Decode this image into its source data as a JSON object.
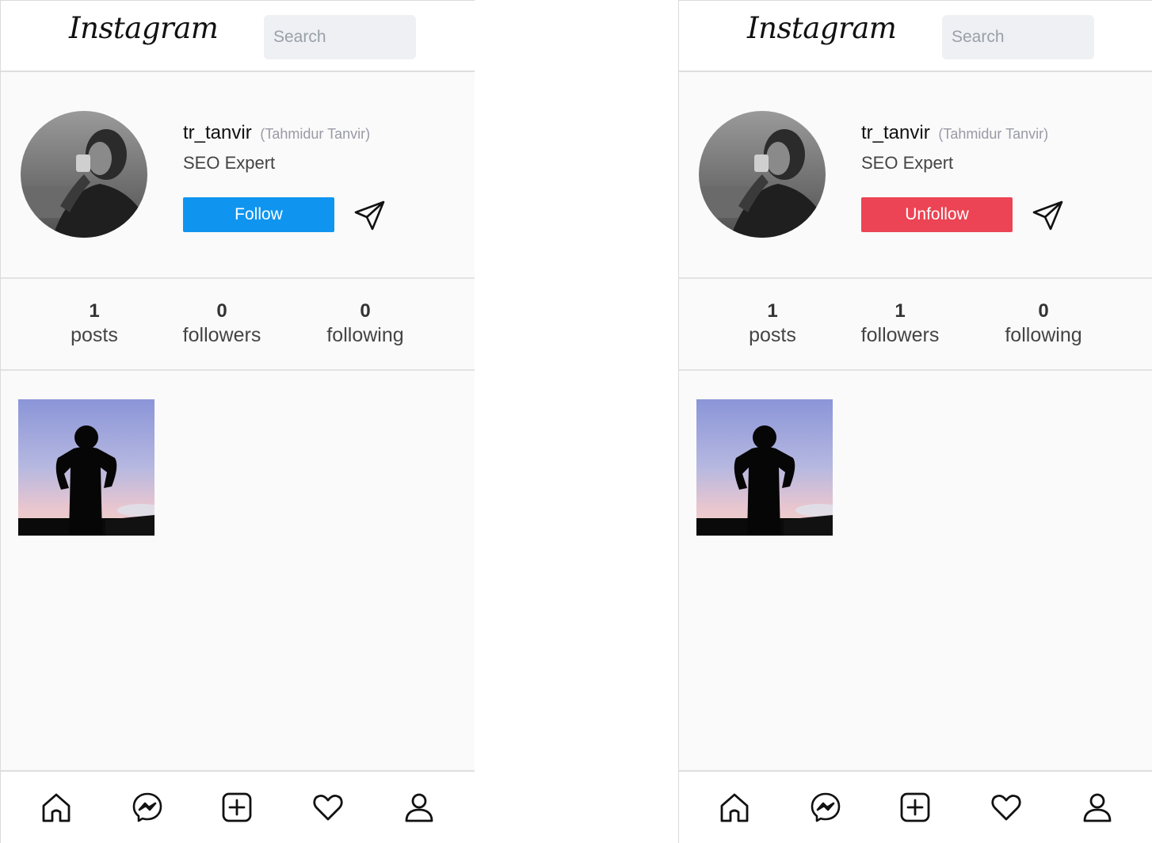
{
  "screens": [
    {
      "logo": "Instagram",
      "search_placeholder": "Search",
      "username": "tr_tanvir",
      "full_name": "(Tahmidur Tanvir)",
      "bio": "SEO Expert",
      "action_button": "Follow",
      "stats": [
        {
          "value": "1",
          "label": "posts"
        },
        {
          "value": "0",
          "label": "followers"
        },
        {
          "value": "0",
          "label": "following"
        }
      ]
    },
    {
      "logo": "Instagram",
      "search_placeholder": "Search",
      "username": "tr_tanvir",
      "full_name": "(Tahmidur Tanvir)",
      "bio": "SEO Expert",
      "action_button": "Unfollow",
      "stats": [
        {
          "value": "1",
          "label": "posts"
        },
        {
          "value": "1",
          "label": "followers"
        },
        {
          "value": "0",
          "label": "following"
        }
      ]
    }
  ],
  "colors": {
    "follow": "#0f95f0",
    "unfollow": "#ec4454"
  },
  "nav_icons": [
    "home-icon",
    "messenger-icon",
    "add-post-icon",
    "heart-icon",
    "profile-icon"
  ]
}
